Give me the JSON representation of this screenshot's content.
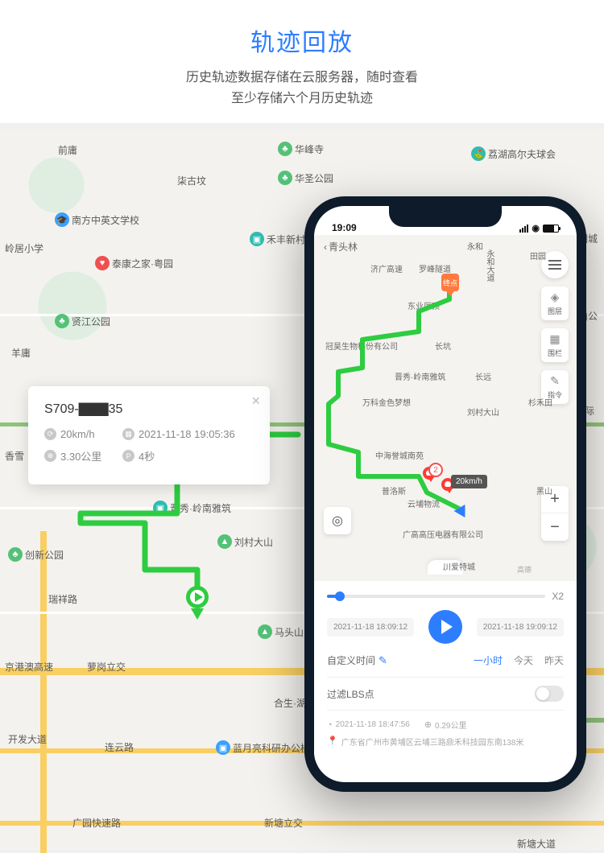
{
  "header": {
    "title": "轨迹回放",
    "line1": "历史轨迹数据存储在云服务器，随时查看",
    "line2": "至少存储六个月历史轨迹"
  },
  "bg_pois": {
    "qianyong": "前庸",
    "qigufen": "柒古坟",
    "huafeng": "华峰寺",
    "huasheng": "华圣公园",
    "lihu": "荔湖高尔夫球会",
    "nanfang": "南方中英文学校",
    "lingju": "岭居小学",
    "hefeng": "禾丰新村",
    "taikang": "泰康之家·粤园",
    "xianjiang": "贤江公园",
    "yangyong": "羊庸",
    "lihucheng": "荔湖城",
    "songshan": "松山公",
    "lingnan": "晋秀·岭南雅筑",
    "liucun": "刘村大山",
    "chuangxin": "创新公园",
    "ruixiang": "瑞祥路",
    "matou": "马头山",
    "jinggang": "京港澳高速",
    "luogang": "萝岗立交",
    "kaifa": "开发大道",
    "lianyun": "连云路",
    "lanyueliang": "蓝月亮科研办公楼",
    "guangyuan": "广园快速路",
    "xintang": "新塘立交",
    "heshenghushan": "合生·湖山",
    "yushan": "誉山国际",
    "xiangxue": "香雪",
    "xintangdadao": "新塘大道"
  },
  "popup": {
    "title": "S709-▇▇▇35",
    "speed": "20km/h",
    "datetime": "2021-11-18 19:05:36",
    "distance": "3.30公里",
    "duration": "4秒"
  },
  "phone": {
    "status_time": "19:09",
    "back_label": "青头林",
    "map_pois": {
      "yonghe": "永和",
      "jiguang": "济广高速",
      "luofeng": "罗峰隧道",
      "dongye": "东业厉顶",
      "guanhao": "冠昊生物科份有公司",
      "changkeng": "长坑",
      "wanke": "万科金色梦想",
      "lingnan": "晋秀·岭南雅筑",
      "changyuan": "长远",
      "liucun": "刘村大山",
      "shanhetian": "杉禾田",
      "zhonghai": "中海誉城南苑",
      "puluo": "普洛斯",
      "yunpu": "云埔物流",
      "gaoya": "广高高压电器有限公司",
      "heishan": "黑山",
      "aite": "川爱特城",
      "tianyuan": "田园",
      "yonghedadao": "永和大道"
    },
    "endflag": "终点",
    "marker_count": "2",
    "speed_tip": "20km/h",
    "controls": {
      "layers": "图层",
      "fence": "围栏",
      "command": "指令"
    },
    "map_attr": "高德",
    "panel": {
      "speed_mult": "X2",
      "start_time": "2021-11-18 18:09:12",
      "end_time": "2021-11-18 19:09:12",
      "custom_label": "自定义时间",
      "range_1h": "一小时",
      "range_today": "今天",
      "range_yesterday": "昨天",
      "lbs_label": "过滤LBS点",
      "footer_time": "2021-11-18 18:47:56",
      "footer_dist": "0.29公里",
      "address": "广东省广州市黄埔区云埔三路鼎禾科技园东南138米"
    }
  }
}
